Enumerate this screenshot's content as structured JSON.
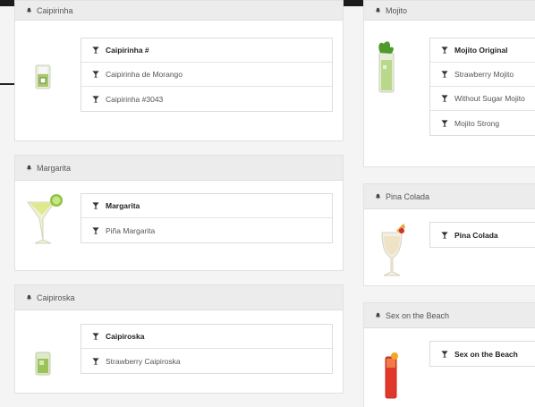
{
  "panels": {
    "caipirinha": {
      "title": "Caipirinha",
      "items": [
        "Caipirinha #",
        "Caipirinha de Morango",
        "Caipirinha #3043"
      ]
    },
    "margarita": {
      "title": "Margarita",
      "items": [
        "Margarita",
        "Piña Margarita"
      ]
    },
    "caipiroska": {
      "title": "Caipiroska",
      "items": [
        "Caipiroska",
        "Strawberry Caipiroska"
      ]
    },
    "mojito": {
      "title": "Mojito",
      "items": [
        "Mojito Original",
        "Strawberry Mojito",
        "Without Sugar Mojito",
        "Mojito Strong"
      ]
    },
    "pina_colada": {
      "title": "Pina Colada",
      "items": [
        "Pina Colada"
      ]
    },
    "sex_on_the_beach": {
      "title": "Sex on the Beach",
      "items": [
        "Sex on the Beach"
      ]
    }
  },
  "colors": {
    "header_bg": "#ececec",
    "panel_border": "#e1e1e1",
    "lime": "#8ec63f",
    "red_drink": "#e0392b"
  },
  "icons": {
    "header": "bell-icon",
    "item": "cocktail-glass-icon"
  }
}
